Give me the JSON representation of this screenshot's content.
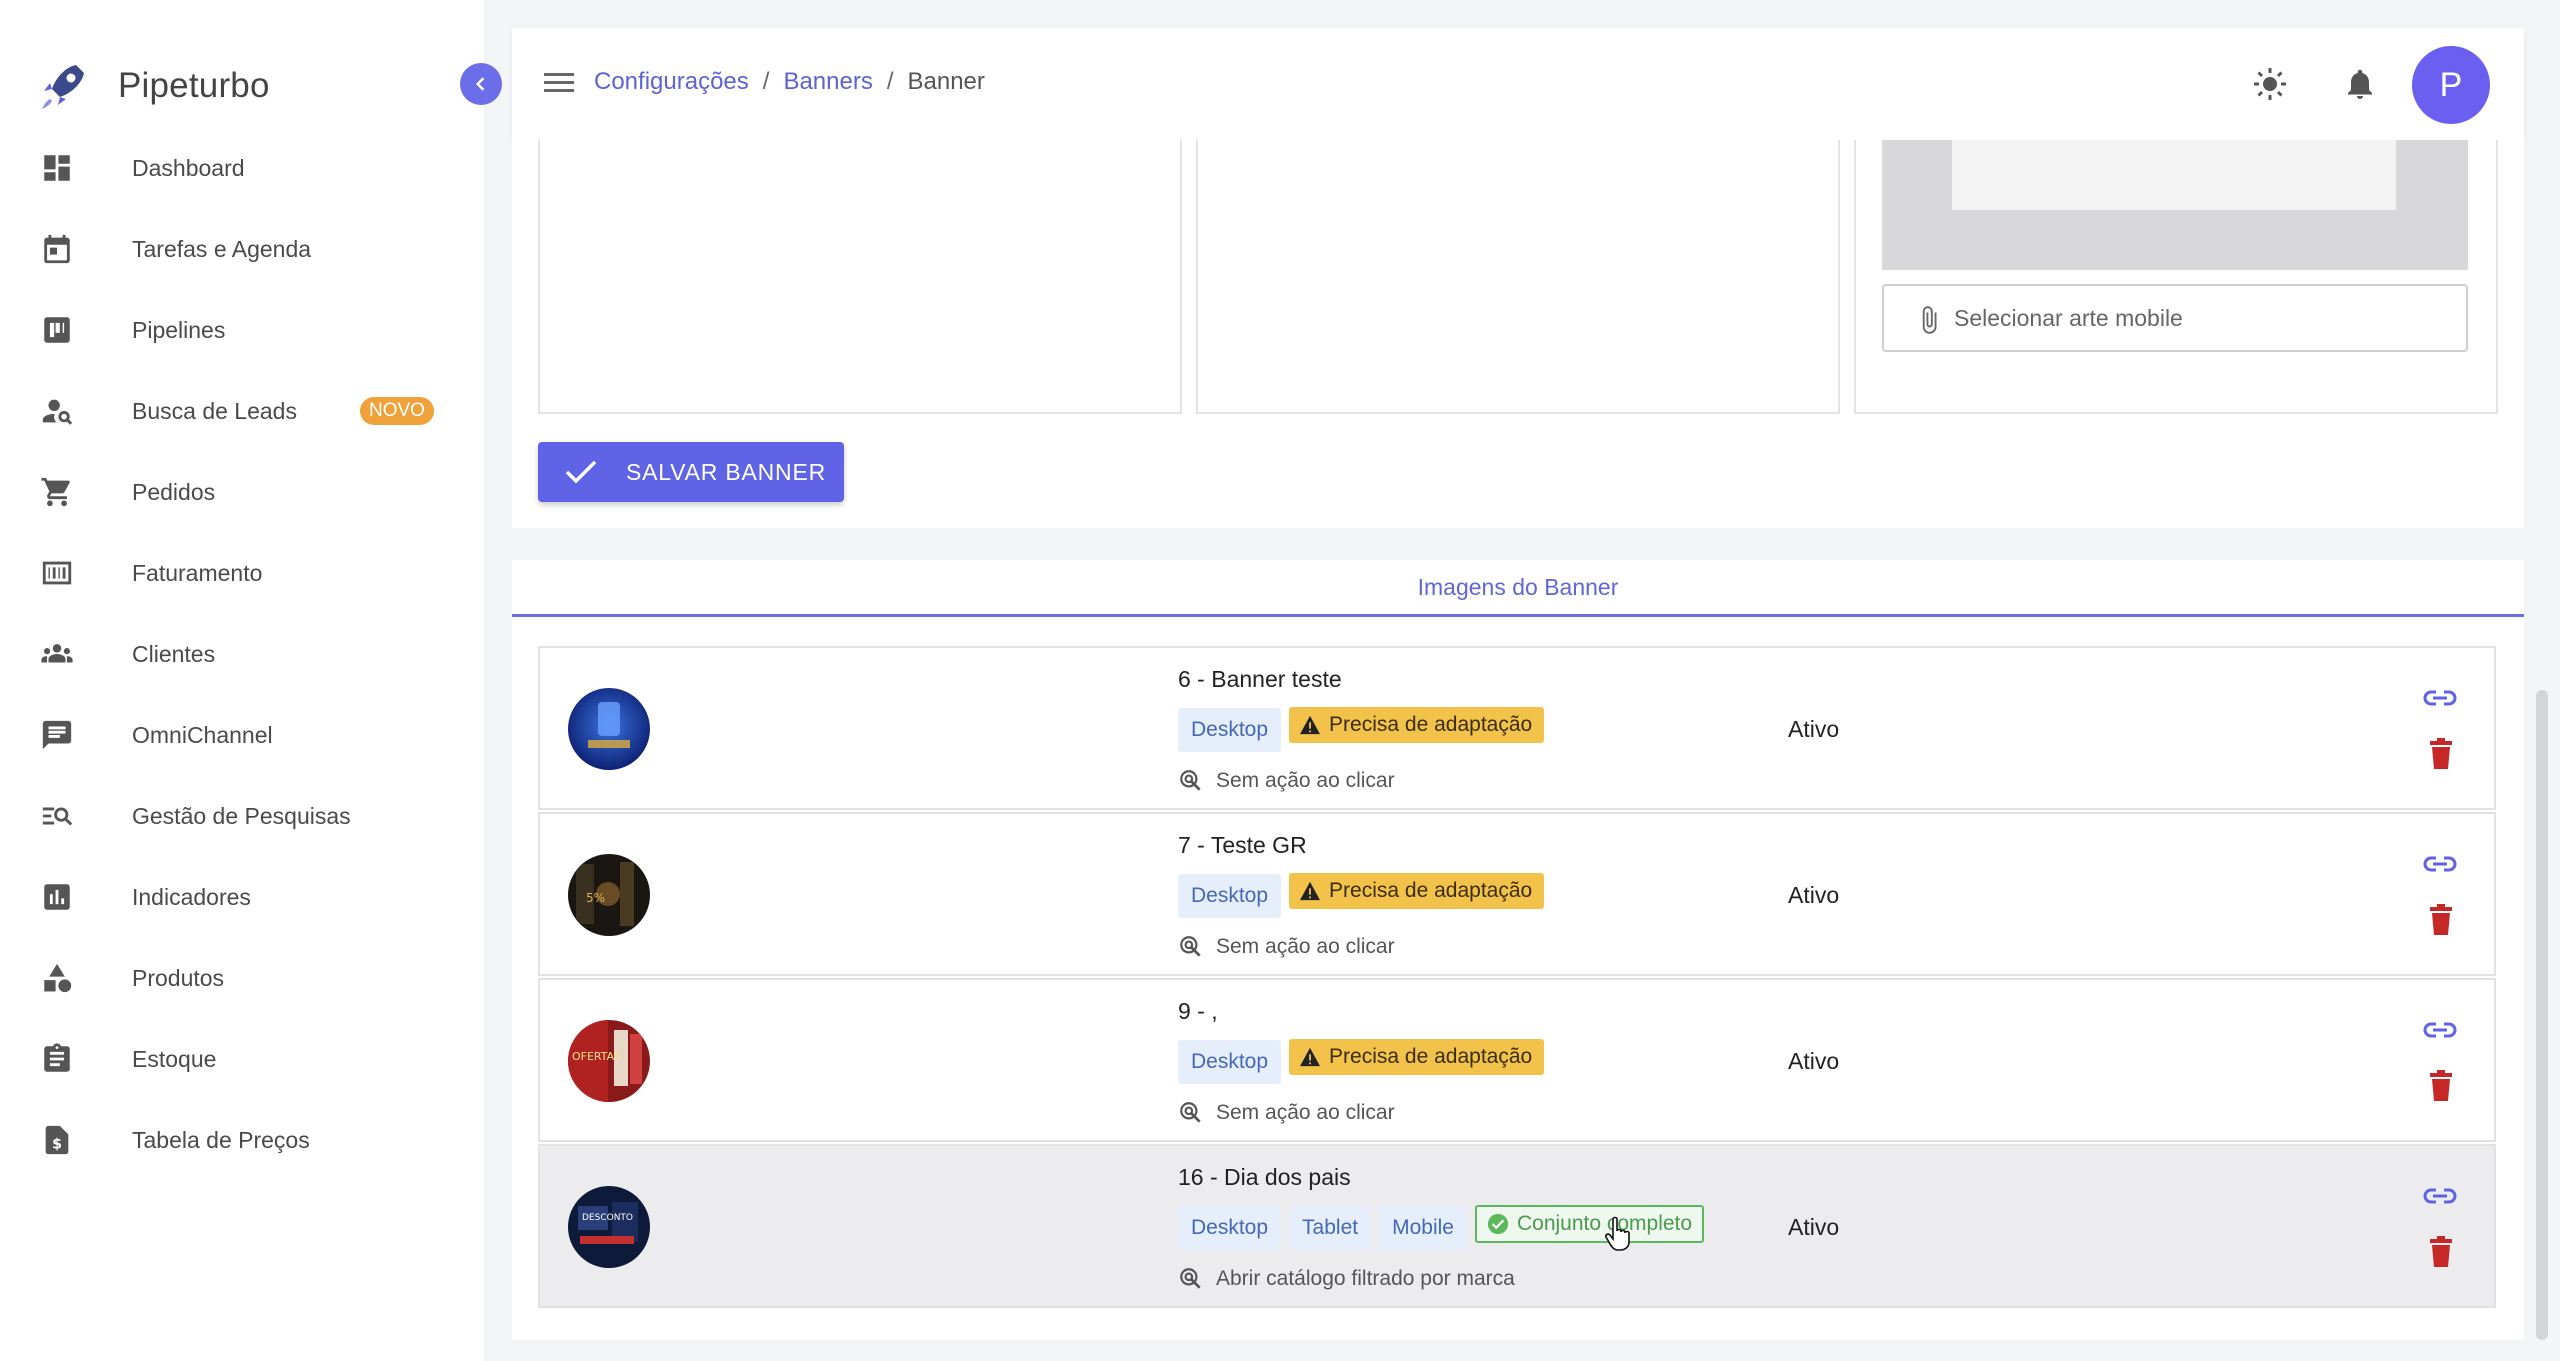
{
  "app": {
    "name": "Pipeturbo"
  },
  "sidebar": {
    "items": [
      {
        "label": "Dashboard",
        "icon": "dashboard-icon"
      },
      {
        "label": "Tarefas e Agenda",
        "icon": "calendar-icon"
      },
      {
        "label": "Pipelines",
        "icon": "kanban-icon"
      },
      {
        "label": "Busca de Leads",
        "icon": "person-search-icon",
        "badge": "NOVO"
      },
      {
        "label": "Pedidos",
        "icon": "cart-icon"
      },
      {
        "label": "Faturamento",
        "icon": "billing-icon"
      },
      {
        "label": "Clientes",
        "icon": "people-icon"
      },
      {
        "label": "OmniChannel",
        "icon": "chat-icon"
      },
      {
        "label": "Gestão de Pesquisas",
        "icon": "search-list-icon"
      },
      {
        "label": "Indicadores",
        "icon": "chart-icon"
      },
      {
        "label": "Produtos",
        "icon": "shapes-icon"
      },
      {
        "label": "Estoque",
        "icon": "clipboard-icon"
      },
      {
        "label": "Tabela de Preços",
        "icon": "price-doc-icon"
      }
    ]
  },
  "header": {
    "breadcrumb": [
      "Configurações",
      "Banners",
      "Banner"
    ],
    "separator": "/",
    "avatar_initial": "P"
  },
  "editor": {
    "mobile_file_placeholder": "Selecionar arte mobile",
    "save_label": "SALVAR BANNER"
  },
  "images": {
    "tab_title": "Imagens do Banner",
    "rows": [
      {
        "title": "6 - Banner teste",
        "devices": [
          "Desktop"
        ],
        "badge": "Precisa de adaptação",
        "badge_type": "warning",
        "action": "Sem ação ao clicar",
        "status": "Ativo"
      },
      {
        "title": "7 - Teste GR",
        "devices": [
          "Desktop"
        ],
        "badge": "Precisa de adaptação",
        "badge_type": "warning",
        "action": "Sem ação ao clicar",
        "status": "Ativo"
      },
      {
        "title": "9 - ,",
        "devices": [
          "Desktop"
        ],
        "badge": "Precisa de adaptação",
        "badge_type": "warning",
        "action": "Sem ação ao clicar",
        "status": "Ativo"
      },
      {
        "title": "16 - Dia dos pais",
        "devices": [
          "Desktop",
          "Tablet",
          "Mobile"
        ],
        "badge": "Conjunto completo",
        "badge_type": "success",
        "action": "Abrir catálogo filtrado por marca",
        "status": "Ativo"
      }
    ]
  },
  "colors": {
    "accent": "#5f63e6",
    "warning": "#f2c24a",
    "success": "#5cb85c",
    "danger": "#c62828"
  }
}
